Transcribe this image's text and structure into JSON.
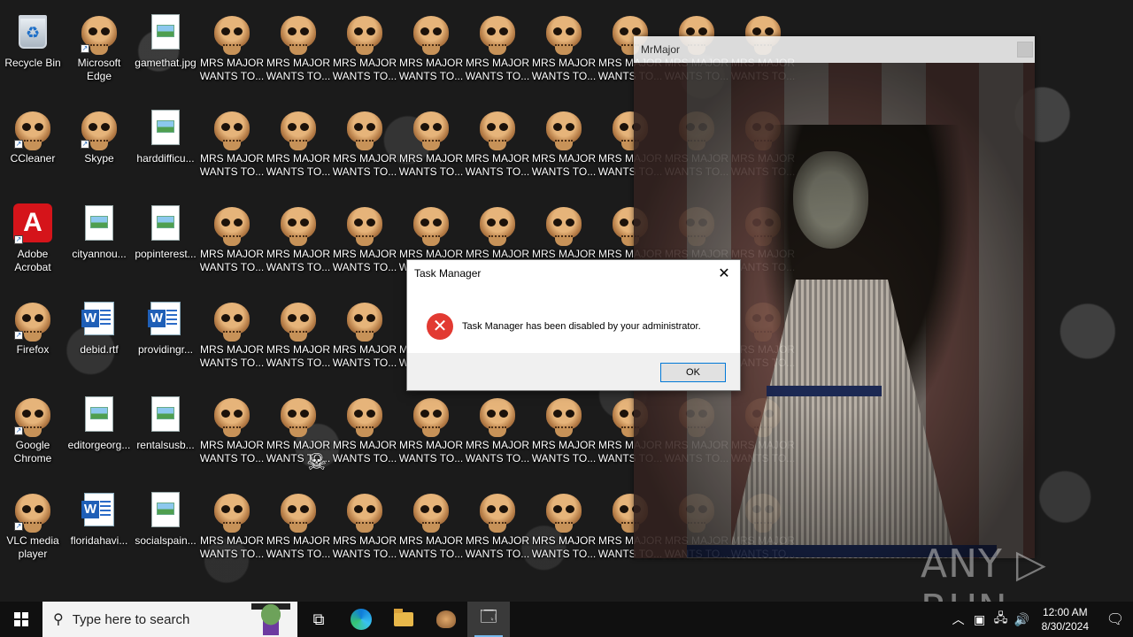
{
  "desktop": {
    "column1": [
      {
        "label": "Recycle Bin",
        "icon": "recycle-bin-icon"
      },
      {
        "label": "CCleaner",
        "icon": "ccleaner-icon"
      },
      {
        "label": "Adobe Acrobat",
        "icon": "acrobat-icon"
      },
      {
        "label": "Firefox",
        "icon": "skull-icon"
      },
      {
        "label": "Google Chrome",
        "icon": "skull-icon"
      },
      {
        "label": "VLC media player",
        "icon": "skull-icon"
      }
    ],
    "column2": [
      {
        "label": "Microsoft Edge",
        "icon": "skull-icon"
      },
      {
        "label": "Skype",
        "icon": "skull-icon"
      },
      {
        "label": "cityannou...",
        "icon": "image-file-icon"
      },
      {
        "label": "debid.rtf",
        "icon": "word-doc-icon"
      },
      {
        "label": "editorgeorg...",
        "icon": "image-file-icon"
      },
      {
        "label": "floridahavi...",
        "icon": "word-doc-icon"
      }
    ],
    "column3": [
      {
        "label": "gamethat.jpg",
        "icon": "image-file-icon"
      },
      {
        "label": "harddifficu...",
        "icon": "image-file-icon"
      },
      {
        "label": "popinterest...",
        "icon": "image-file-icon"
      },
      {
        "label": "providingr...",
        "icon": "word-doc-icon"
      },
      {
        "label": "rentalsusb...",
        "icon": "image-file-icon"
      },
      {
        "label": "socialspain...",
        "icon": "image-file-icon"
      }
    ],
    "skull_label": "MRS MAJOR WANTS TO..."
  },
  "mrmajor_window": {
    "title": "MrMajor"
  },
  "dialog": {
    "title": "Task Manager",
    "message": "Task Manager has been disabled by your administrator.",
    "ok_label": "OK",
    "close_glyph": "✕"
  },
  "watermark": "ANY ▷ RUN",
  "taskbar": {
    "search_placeholder": "Type here to search",
    "time": "12:00 AM",
    "date": "8/30/2024"
  }
}
